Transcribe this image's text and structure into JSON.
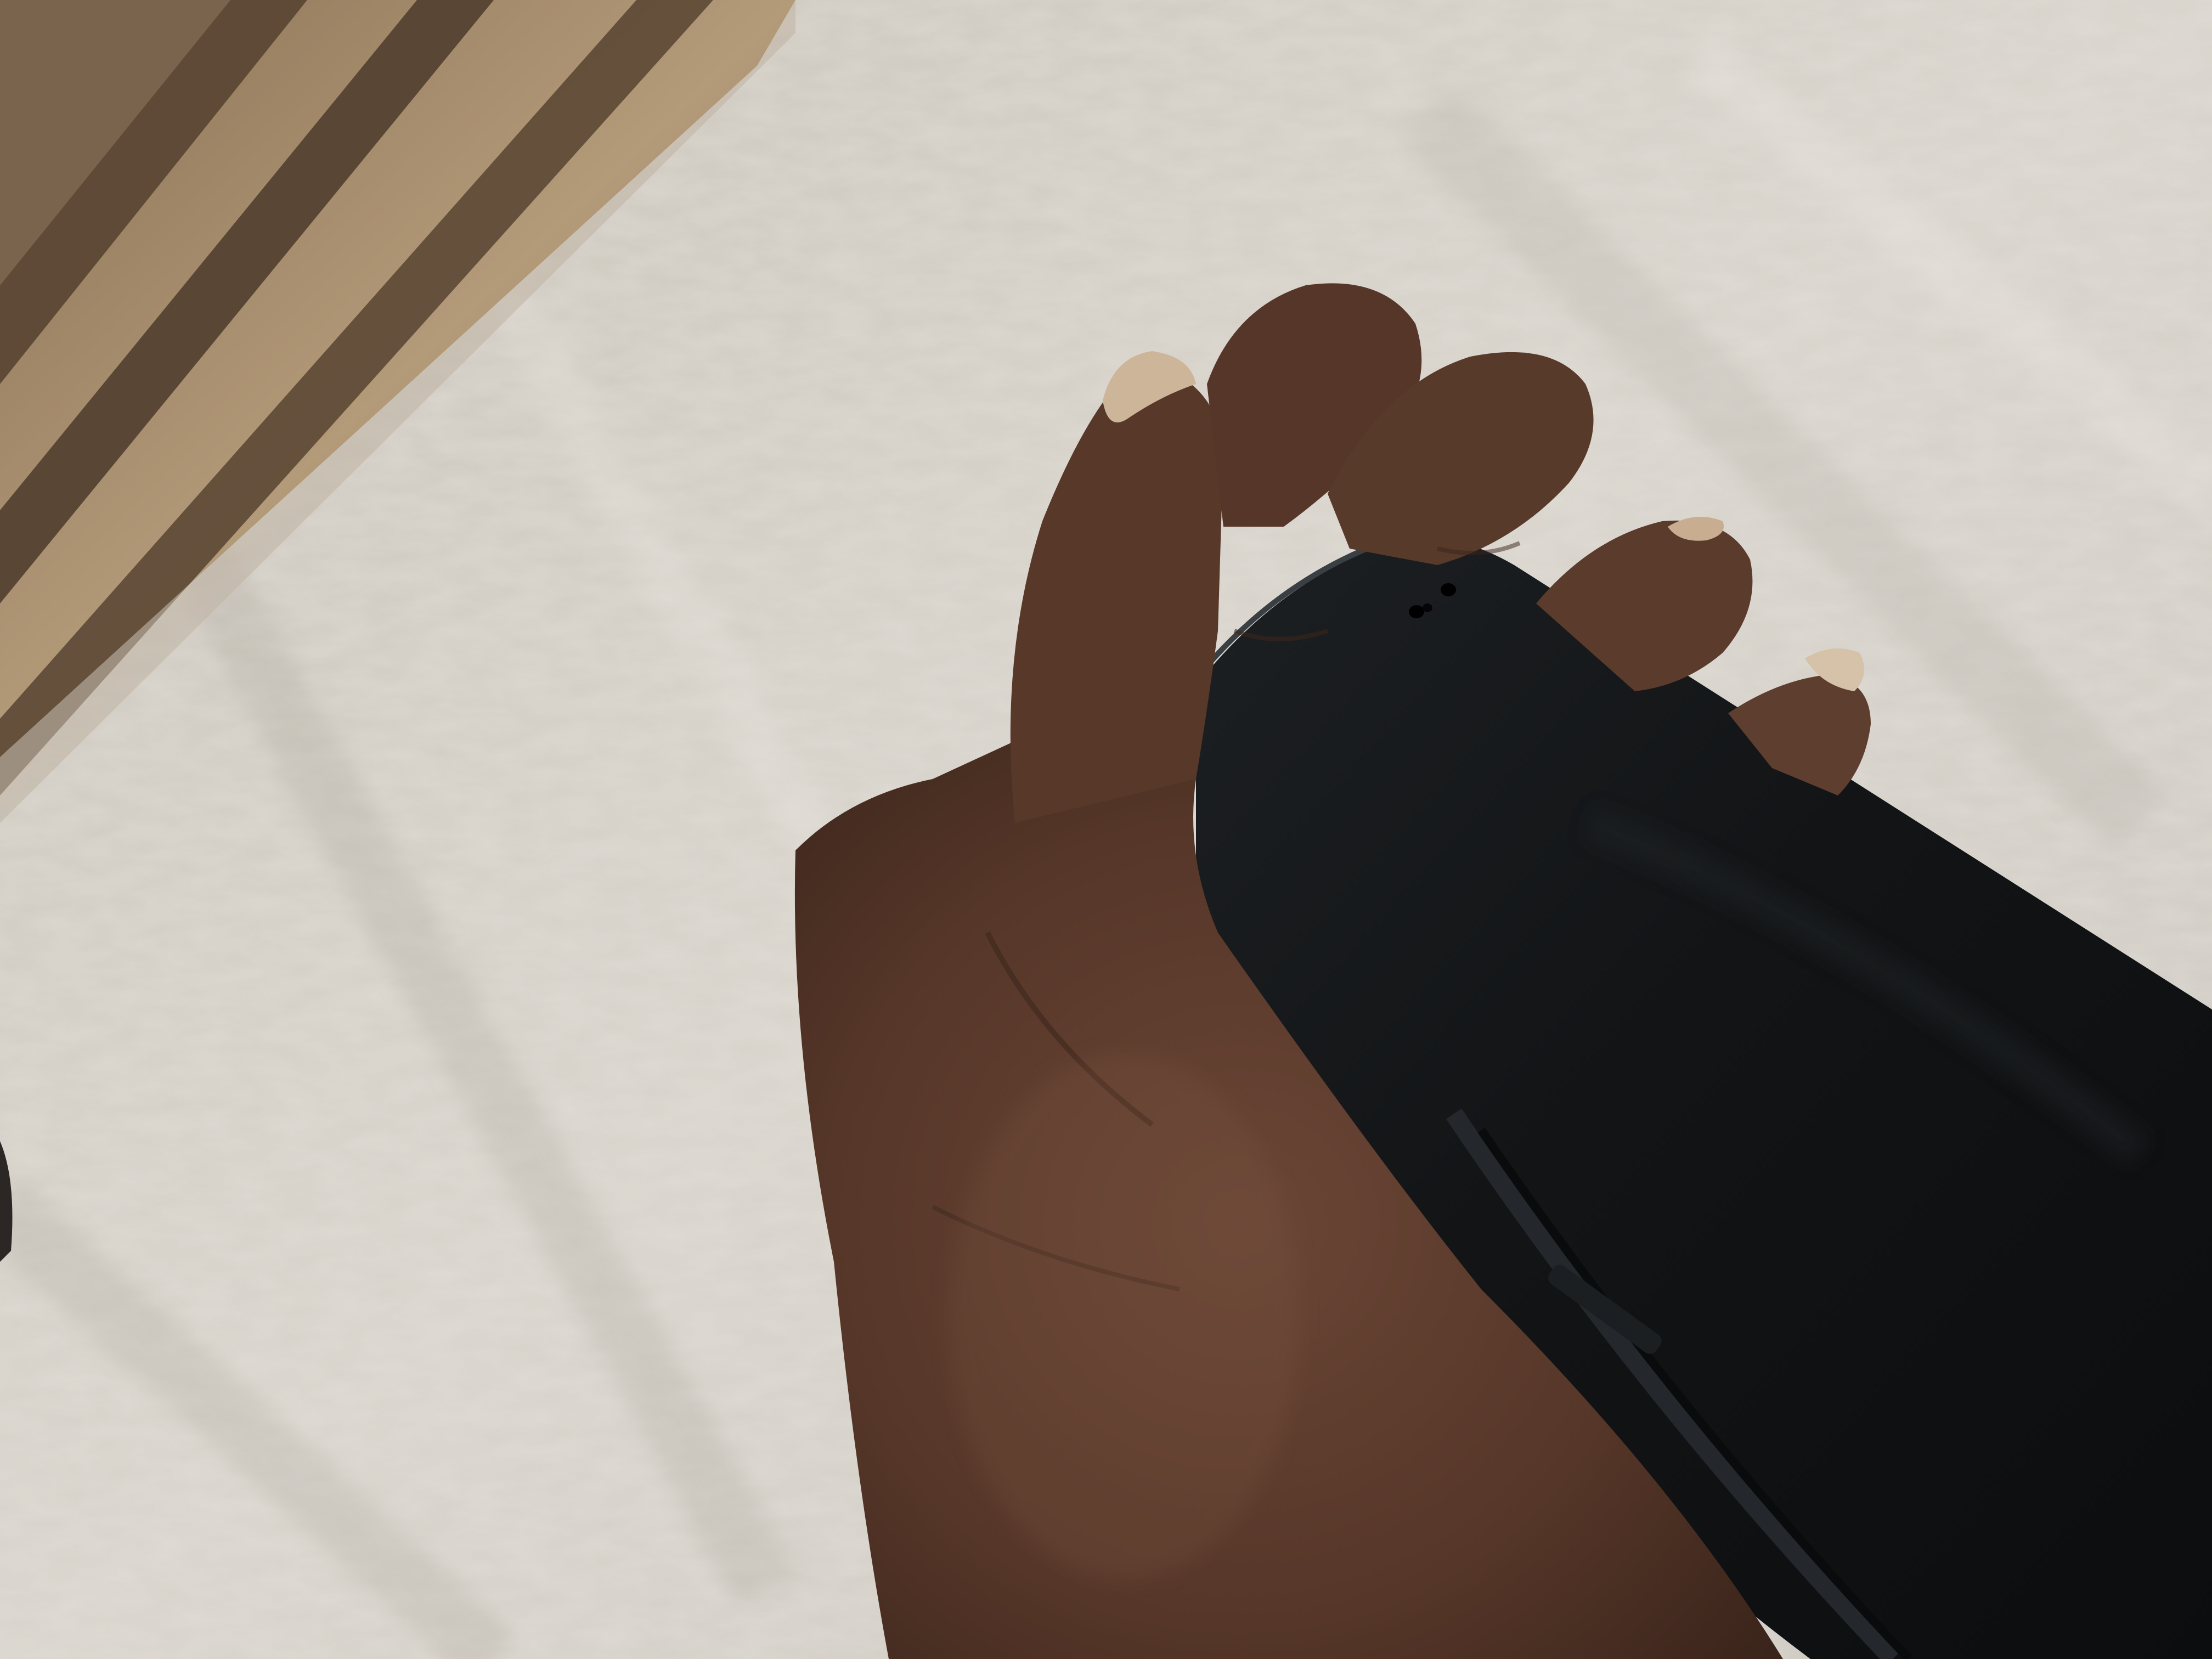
{
  "photo": {
    "subject": "hand-holding-phone",
    "colors": {
      "floor": "#d4d0c8",
      "floor_shadow": "#b9b4ab",
      "wood": "#a48b6b",
      "wood_dark": "#6b5640",
      "skin": "#5a3b2e",
      "skin_dark": "#3e2820",
      "skin_light": "#7a5444",
      "nail": "#d8c3a6",
      "phone": "#151719",
      "phone_edge": "#2a2e32"
    }
  }
}
